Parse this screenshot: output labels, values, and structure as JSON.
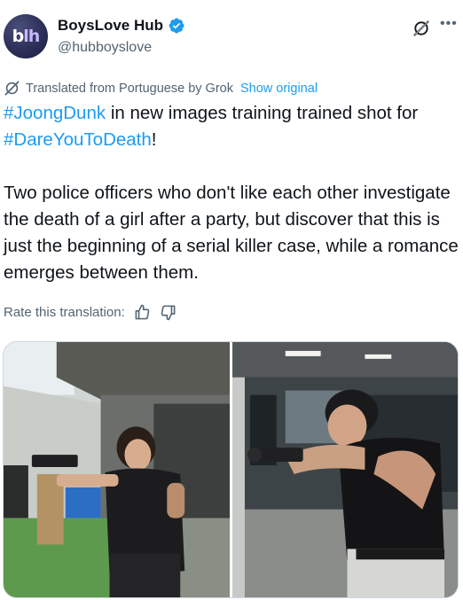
{
  "author": {
    "display_name": "BoysLove Hub",
    "handle": "@hubboyslove",
    "avatar_text_main": "b",
    "avatar_text_accent": "lh"
  },
  "translation": {
    "notice": "Translated from Portuguese by Grok",
    "show_original": "Show original"
  },
  "tweet": {
    "hashtag1": "#JoongDunk",
    "line1_text": " in new images training trained shot for",
    "hashtag2": "#DareYouToDeath",
    "line2_text": "!",
    "paragraph2": "Two police officers who don't like each other investigate the death of a girl after a party, but discover that this is just the beginning of a serial killer case, while a romance emerges between them."
  },
  "rate": {
    "label": "Rate this translation:"
  },
  "icons": {
    "verified": "verified-badge-icon",
    "grok": "grok-icon",
    "more": "more-icon",
    "thumbs_up": "thumbs-up-icon",
    "thumbs_down": "thumbs-down-icon"
  },
  "colors": {
    "link": "#1d9bf0",
    "text": "#0f1419",
    "secondary": "#536471"
  }
}
